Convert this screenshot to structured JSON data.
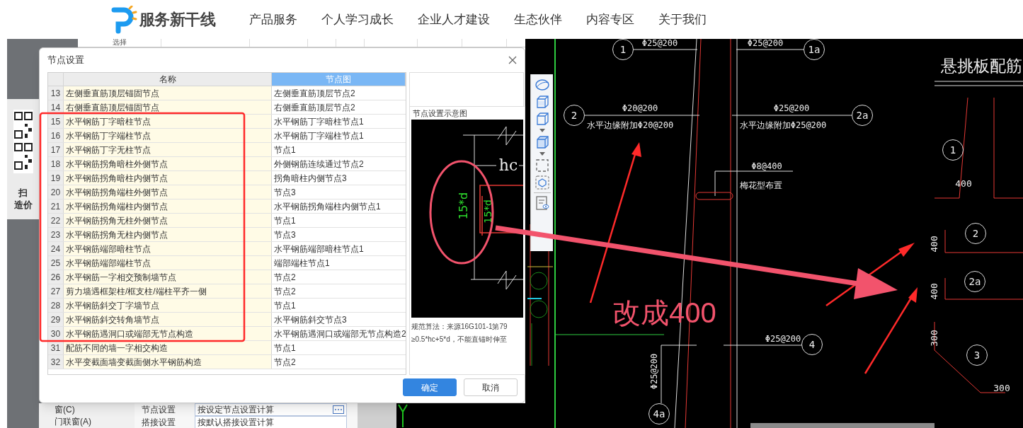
{
  "site_header": {
    "logo_text": "服务新干线",
    "nav": [
      "产品服务",
      "个人学习成长",
      "企业人才建设",
      "生态伙伴",
      "内容专区",
      "关于我们"
    ]
  },
  "promo_panel": {
    "texts": [
      "扫",
      "造价"
    ]
  },
  "app": {
    "header_cell": "选择",
    "categories": [
      "窗(C)",
      "门联窗(A)"
    ],
    "properties": [
      {
        "name": "节点设置",
        "value": "按设定节点设置计算",
        "kind": "picker"
      },
      {
        "name": "搭接设置",
        "value": "按默认搭接设置计算",
        "kind": "plain"
      }
    ]
  },
  "dialog": {
    "title": "节点设置",
    "columns": [
      {
        "label": "名称",
        "selected": false
      },
      {
        "label": "节点图",
        "selected": true
      }
    ],
    "rows": [
      {
        "index": "13",
        "name": "左侧垂直筋顶层锚固节点",
        "diagram": "左侧垂直筋顶层节点2"
      },
      {
        "index": "14",
        "name": "右侧垂直筋顶层锚固节点",
        "diagram": "右侧垂直筋顶层节点2"
      },
      {
        "index": "15",
        "name": "水平钢筋丁字暗柱节点",
        "diagram": "水平钢筋丁字暗柱节点1"
      },
      {
        "index": "16",
        "name": "水平钢筋丁字端柱节点",
        "diagram": "水平钢筋丁字端柱节点1"
      },
      {
        "index": "17",
        "name": "水平钢筋丁字无柱节点",
        "diagram": "节点1"
      },
      {
        "index": "18",
        "name": "水平钢筋拐角暗柱外侧节点",
        "diagram": "外侧钢筋连续通过节点2"
      },
      {
        "index": "19",
        "name": "水平钢筋拐角暗柱内侧节点",
        "diagram": "拐角暗柱内侧节点3"
      },
      {
        "index": "20",
        "name": "水平钢筋拐角端柱外侧节点",
        "diagram": "节点3"
      },
      {
        "index": "21",
        "name": "水平钢筋拐角端柱内侧节点",
        "diagram": "水平钢筋拐角端柱内侧节点1"
      },
      {
        "index": "22",
        "name": "水平钢筋拐角无柱外侧节点",
        "diagram": "节点1"
      },
      {
        "index": "23",
        "name": "水平钢筋拐角无柱内侧节点",
        "diagram": "节点3"
      },
      {
        "index": "24",
        "name": "水平钢筋端部暗柱节点",
        "diagram": "水平钢筋端部暗柱节点1"
      },
      {
        "index": "25",
        "name": "水平钢筋端部端柱节点",
        "diagram": "端部端柱节点1"
      },
      {
        "index": "26",
        "name": "水平钢筋一字相交预制墙节点",
        "diagram": "节点2"
      },
      {
        "index": "27",
        "name": "剪力墙遇框架柱/框支柱/端柱平齐一侧",
        "diagram": "节点2"
      },
      {
        "index": "28",
        "name": "水平钢筋斜交丁字墙节点",
        "diagram": "节点1"
      },
      {
        "index": "29",
        "name": "水平钢筋斜交转角墙节点",
        "diagram": "水平钢筋斜交节点3"
      },
      {
        "index": "30",
        "name": "水平钢筋遇洞口或端部无节点构造",
        "diagram": "水平钢筋遇洞口或端部无节点构造2"
      },
      {
        "index": "31",
        "name": "配筋不同的墙一字相交构造",
        "diagram": "节点1"
      },
      {
        "index": "32",
        "name": "水平变截面墙变截面侧水平钢筋构造",
        "diagram": "节点2"
      }
    ],
    "preview": {
      "title": "节点设置示意图",
      "labels": [
        "hc",
        "15*d",
        "15*d"
      ],
      "rule_lines": [
        "规范算法：来源16G101-1第79",
        "≥0.5*hc+5*d，不能直锚时伸至"
      ]
    },
    "buttons": [
      {
        "label": "确定",
        "kind": "primary"
      },
      {
        "label": "取消",
        "kind": "secondary"
      }
    ]
  },
  "cad": {
    "labels": [
      {
        "text": "1",
        "kind": "callout"
      },
      {
        "text": "Φ25@200",
        "kind": "note"
      },
      {
        "text": "Φ25@200",
        "kind": "note"
      },
      {
        "text": "1a",
        "kind": "callout"
      },
      {
        "text": "悬挑板配筋",
        "kind": "title"
      },
      {
        "text": "2",
        "kind": "callout"
      },
      {
        "text": "Φ20@200",
        "kind": "note"
      },
      {
        "text": "水平边缘附加Φ20@200",
        "kind": "note"
      },
      {
        "text": "Φ25@200",
        "kind": "note"
      },
      {
        "text": "2a",
        "kind": "callout"
      },
      {
        "text": "水平边缘附加Φ25@200",
        "kind": "note"
      },
      {
        "text": "1",
        "kind": "callout"
      },
      {
        "text": "Φ8@400",
        "kind": "note"
      },
      {
        "text": "梅花型布置",
        "kind": "note"
      },
      {
        "text": "400",
        "kind": "dimension"
      },
      {
        "text": "2",
        "kind": "callout"
      },
      {
        "text": "400",
        "kind": "dimension"
      },
      {
        "text": "2a",
        "kind": "callout"
      },
      {
        "text": "400",
        "kind": "dimension"
      },
      {
        "text": "300",
        "kind": "dimension"
      },
      {
        "text": "Φ25@200",
        "kind": "note"
      },
      {
        "text": "4",
        "kind": "callout"
      },
      {
        "text": "3",
        "kind": "callout"
      },
      {
        "text": "Φ25@200",
        "kind": "note"
      },
      {
        "text": "300",
        "kind": "dimension"
      },
      {
        "text": "4a",
        "kind": "callout"
      }
    ]
  },
  "annotation": {
    "text": "改成400"
  }
}
